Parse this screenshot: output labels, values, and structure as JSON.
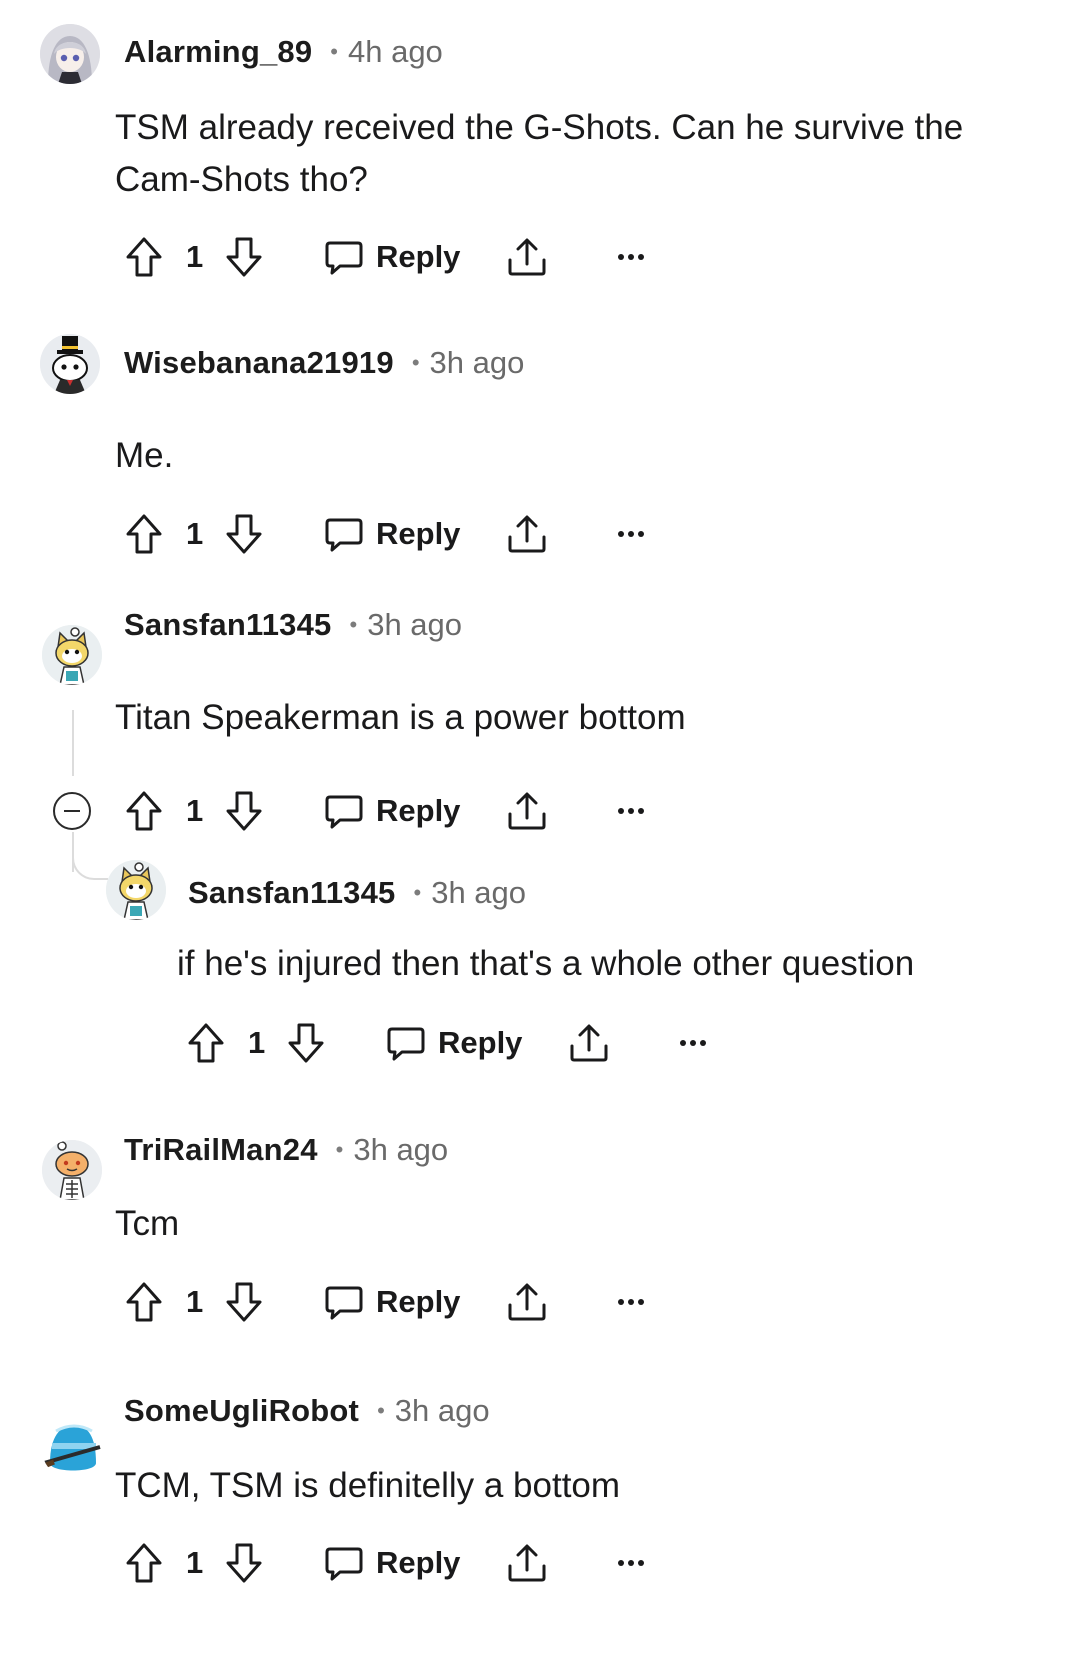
{
  "comments": [
    {
      "author": "Alarming_89",
      "separator": "•",
      "time": "4h ago",
      "body": "TSM already received the G-Shots. Can he survive the Cam-Shots tho?",
      "score": "1",
      "reply_label": "Reply"
    },
    {
      "author": "Wisebanana21919",
      "separator": "•",
      "time": "3h ago",
      "body": "Me.",
      "score": "1",
      "reply_label": "Reply"
    },
    {
      "author": "Sansfan11345",
      "separator": "•",
      "time": "3h ago",
      "body": "Titan Speakerman is a power bottom",
      "score": "1",
      "reply_label": "Reply"
    },
    {
      "author": "Sansfan11345",
      "separator": "•",
      "time": "3h ago",
      "body": "if he's injured then that's a whole other question",
      "score": "1",
      "reply_label": "Reply"
    },
    {
      "author": "TriRailMan24",
      "separator": "•",
      "time": "3h ago",
      "body": "Tcm",
      "score": "1",
      "reply_label": "Reply"
    },
    {
      "author": "SomeUgliRobot",
      "separator": "•",
      "time": "3h ago",
      "body": "TCM, TSM is definitelly a bottom",
      "score": "1",
      "reply_label": "Reply"
    }
  ],
  "icons": {
    "upvote": "arrow-up-outline-icon",
    "downvote": "arrow-down-outline-icon",
    "reply": "speech-bubble-icon",
    "share": "share-upload-icon",
    "more": "more-dots-icon",
    "collapse": "collapse-minus-icon"
  },
  "colors": {
    "text": "#1a1a1b",
    "meta": "#6a6a6a",
    "thread_line": "#dcdcdc",
    "background": "#ffffff"
  }
}
